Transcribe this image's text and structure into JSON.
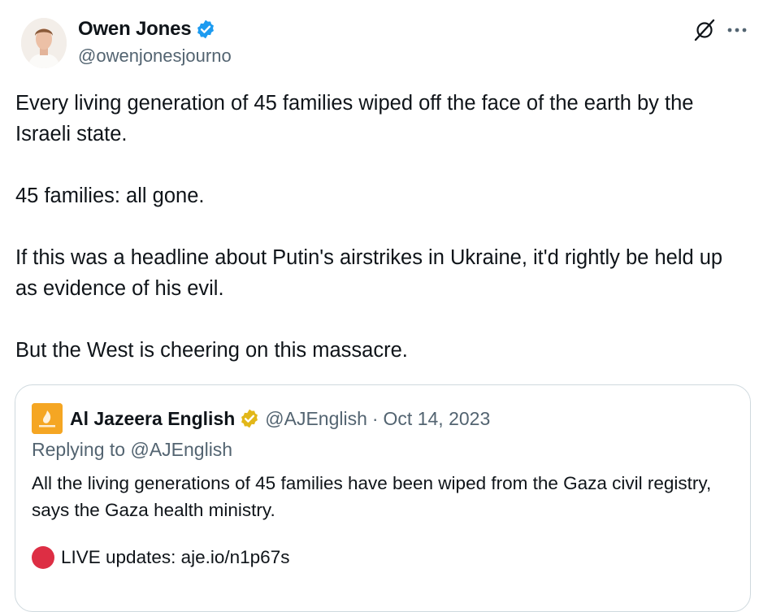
{
  "author": {
    "display_name": "Owen Jones",
    "handle": "@owenjonesjourno",
    "verified_color": "#1d9bf0"
  },
  "actions": {
    "grok_icon": "grok-icon",
    "more_icon": "more-icon"
  },
  "tweet": {
    "paragraphs": [
      "Every living generation of 45 families wiped off the face of the earth by the Israeli state.",
      "45 families: all gone.",
      "If this was a headline about Putin's airstrikes in Ukraine, it'd rightly be held up as evidence of his evil.",
      "But the West is cheering on this massacre."
    ]
  },
  "quoted_tweet": {
    "display_name": "Al Jazeera English",
    "handle": "@AJEnglish",
    "separator": "·",
    "date": "Oct 14, 2023",
    "replying_prefix": "Replying to",
    "replying_to": "@AJEnglish",
    "text": "All the living generations of 45 families have been wiped from the Gaza civil registry, says the Gaza health ministry.",
    "live_text": "LIVE updates: aje.io/n1p67s",
    "badge_color": "#e2b719",
    "avatar_color": "#f5a623",
    "live_dot_color": "#dd2e44"
  }
}
